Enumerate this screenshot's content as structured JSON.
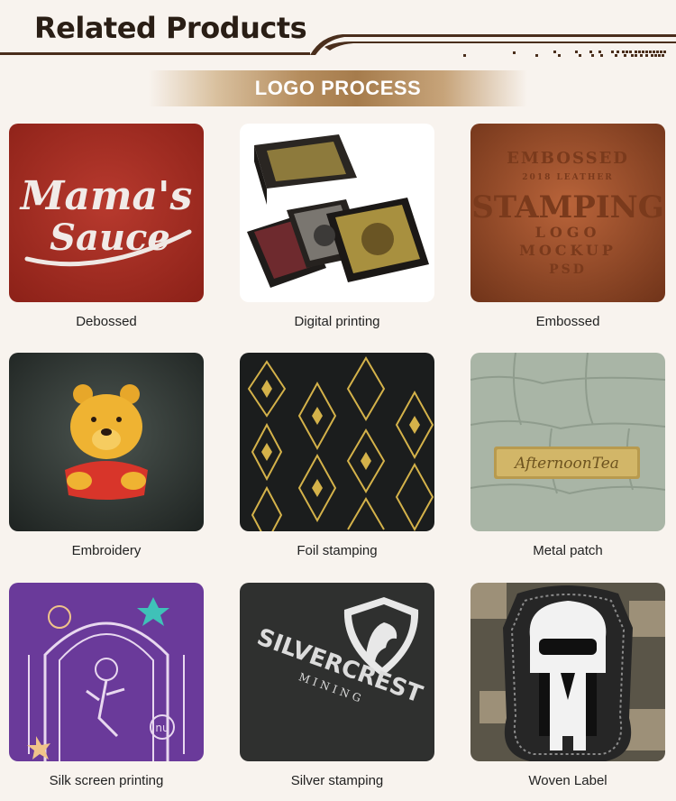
{
  "header": {
    "title": "Related Products"
  },
  "banner": {
    "label": "LOGO PROCESS"
  },
  "products": [
    {
      "label": "Debossed",
      "image_text": [
        "Mama's",
        "Sauce"
      ]
    },
    {
      "label": "Digital printing"
    },
    {
      "label": "Embossed",
      "image_text": [
        "EMBOSSED",
        "2018 LEATHER",
        "STAMPING",
        "LOGO",
        "MOCKUP",
        "PSD"
      ]
    },
    {
      "label": "Embroidery"
    },
    {
      "label": "Foil stamping"
    },
    {
      "label": "Metal patch",
      "image_text": [
        "AfternoonTea"
      ]
    },
    {
      "label": "Silk screen printing",
      "image_text": [
        "nu"
      ]
    },
    {
      "label": "Silver stamping",
      "image_text": [
        "SILVERCREST",
        "MINING"
      ]
    },
    {
      "label": "Woven Label"
    }
  ],
  "colors": {
    "header_text": "#2a1e15",
    "header_line": "#4a2e1c",
    "banner_gold": "#b58d5e",
    "background": "#f8f3ee"
  }
}
